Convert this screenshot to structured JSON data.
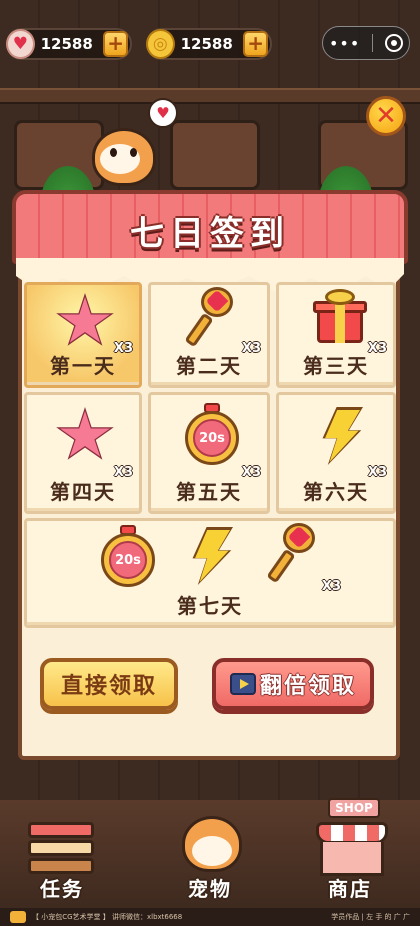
{
  "hud": {
    "hearts_value": "12588",
    "coins_value": "12588",
    "plus_label": "+"
  },
  "dialog": {
    "title": "七日签到",
    "close_symbol": "✕",
    "days": [
      {
        "label": "第一天",
        "reward": "star",
        "quantity": "X3",
        "claimed": true
      },
      {
        "label": "第二天",
        "reward": "key",
        "quantity": "X3",
        "claimed": false
      },
      {
        "label": "第三天",
        "reward": "gift",
        "quantity": "X3",
        "claimed": false
      },
      {
        "label": "第四天",
        "reward": "star",
        "quantity": "X3",
        "claimed": false
      },
      {
        "label": "第五天",
        "reward": "timer",
        "quantity": "X3",
        "claimed": false
      },
      {
        "label": "第六天",
        "reward": "lightning",
        "quantity": "X3",
        "claimed": false
      },
      {
        "label": "第七天",
        "reward": "timer, lightning, key",
        "quantity": "X3",
        "claimed": false
      }
    ],
    "timer_text": "20s",
    "buttons": {
      "direct_claim": "直接领取",
      "double_claim": "翻倍领取"
    }
  },
  "nav": {
    "tasks": "任务",
    "pets": "宠物",
    "shop": "商店",
    "shop_sign": "SHOP"
  },
  "footer": {
    "left": "【 小宠包CG艺术学堂 】  讲师微信：xlbxt6668",
    "right": "学员作品  |    左 手 的 广 广"
  },
  "colors": {
    "accent_red": "#e85f63",
    "accent_gold": "#f7c24a",
    "panel_bg": "#fbefd7"
  }
}
